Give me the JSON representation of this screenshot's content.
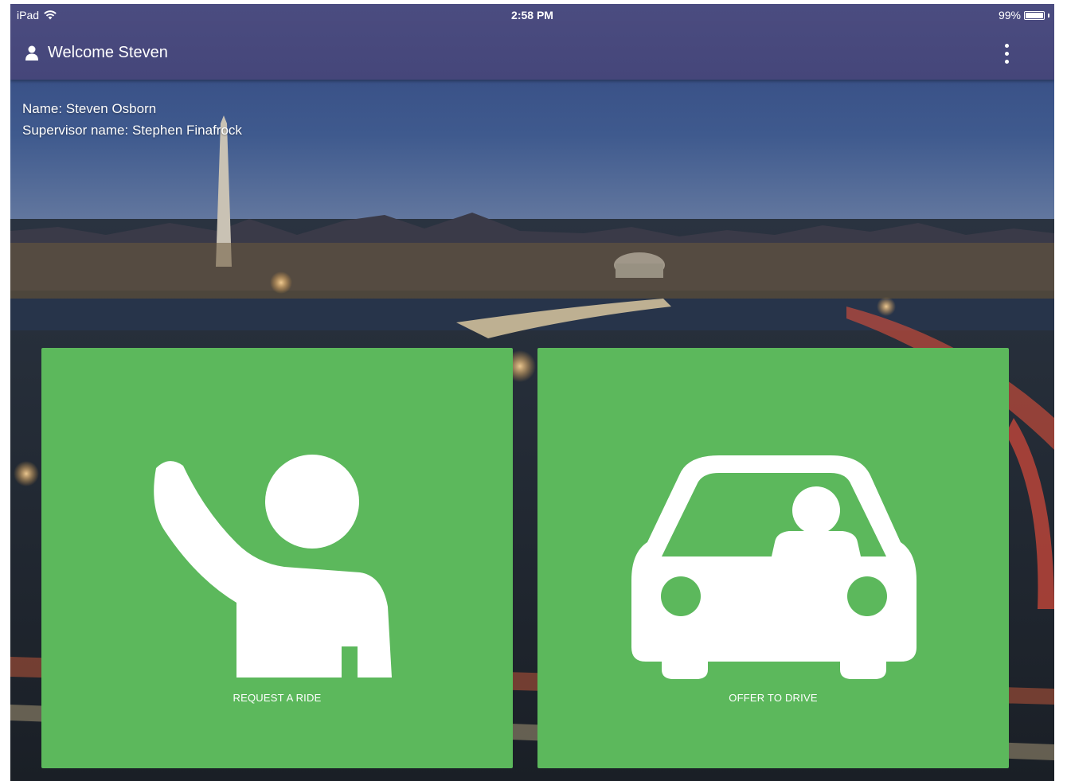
{
  "status_bar": {
    "device": "iPad",
    "time": "2:58 PM",
    "battery": "99%",
    "battery_level": 0.99
  },
  "header": {
    "welcome": "Welcome Steven",
    "user_icon": "user-icon",
    "menu_icon": "vertical-dots-icon"
  },
  "info": {
    "name_line": "Name: Steven Osborn",
    "supervisor_line": "Supervisor name: Stephen Finafrock"
  },
  "actions": {
    "request": {
      "label": "REQUEST A RIDE",
      "icon": "raised-hand-person-icon"
    },
    "offer": {
      "label": "OFFER TO DRIVE",
      "icon": "car-with-driver-icon"
    }
  },
  "colors": {
    "header": "#4b4c80",
    "tile": "#5cb85c"
  }
}
